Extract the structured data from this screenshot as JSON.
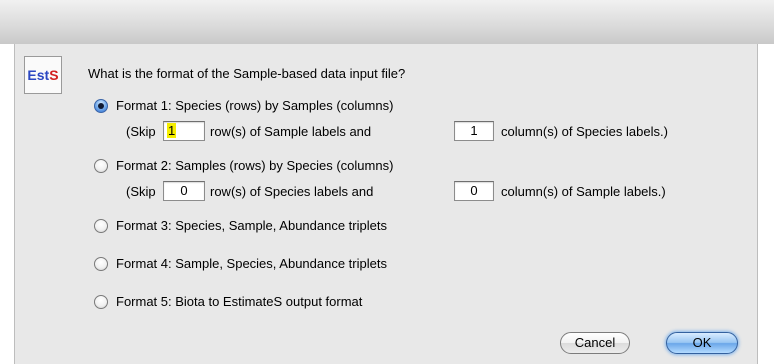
{
  "logo": {
    "part1": "Est",
    "part2": "S"
  },
  "question": "What is the format of the Sample-based data input file?",
  "formats": [
    {
      "label": "Format 1: Species (rows) by Samples (columns)",
      "selected": true,
      "skip_prefix": "(Skip",
      "skip_rows": "1",
      "rows_text": "row(s) of Sample labels and",
      "skip_cols": "1",
      "cols_text": "column(s) of Species labels.)"
    },
    {
      "label": "Format 2: Samples (rows) by Species (columns)",
      "selected": false,
      "skip_prefix": "(Skip",
      "skip_rows": "0",
      "rows_text": "row(s) of Species labels and",
      "skip_cols": "0",
      "cols_text": "column(s) of Sample labels.)"
    },
    {
      "label": "Format 3: Species, Sample, Abundance triplets",
      "selected": false
    },
    {
      "label": "Format 4: Sample, Species, Abundance triplets",
      "selected": false
    },
    {
      "label": "Format 5: Biota to EstimateS output format",
      "selected": false
    }
  ],
  "buttons": {
    "cancel": "Cancel",
    "ok": "OK"
  }
}
